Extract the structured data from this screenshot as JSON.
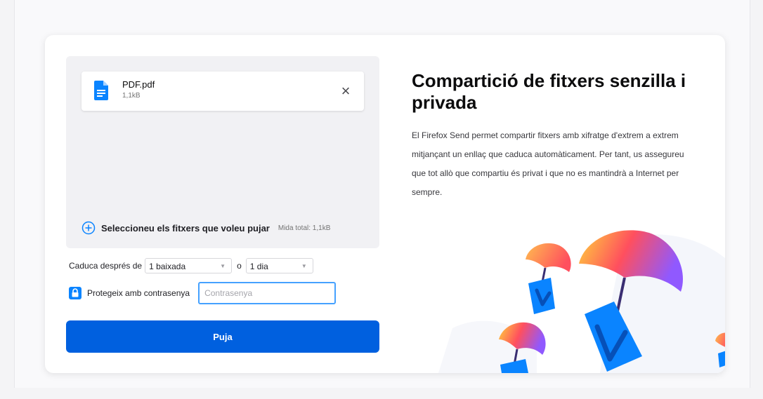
{
  "file": {
    "name": "PDF.pdf",
    "size": "1,1kB",
    "remove_glyph": "×"
  },
  "select_files": {
    "label": "Seleccioneu els fitxers que voleu pujar",
    "total_size": "Mida total: 1,1kB"
  },
  "expiry": {
    "prefix": "Caduca després de",
    "downloads_value": "1 baixada",
    "separator": "o",
    "time_value": "1 dia"
  },
  "password": {
    "label": "Protegeix amb contrasenya",
    "placeholder": "Contrasenya",
    "value": ""
  },
  "upload_button": {
    "label": "Puja"
  },
  "promo": {
    "headline": "Compartició de fitxers senzilla i privada",
    "description": "El Firefox Send permet compartir fitxers amb xifratge d'extrem a extrem mitjançant un enllaç que caduca automàticament. Per tant, us assegureu que tot allò que compartiu és privat i que no es mantindrà a Internet per sempre."
  },
  "colors": {
    "primary_button": "#0060df",
    "accent_blue": "#0a84ff",
    "input_focus": "#45a1ff"
  },
  "icons": [
    "file-document-icon",
    "close-icon",
    "plus-circle-icon",
    "lock-icon",
    "dropdown-caret-icon"
  ]
}
